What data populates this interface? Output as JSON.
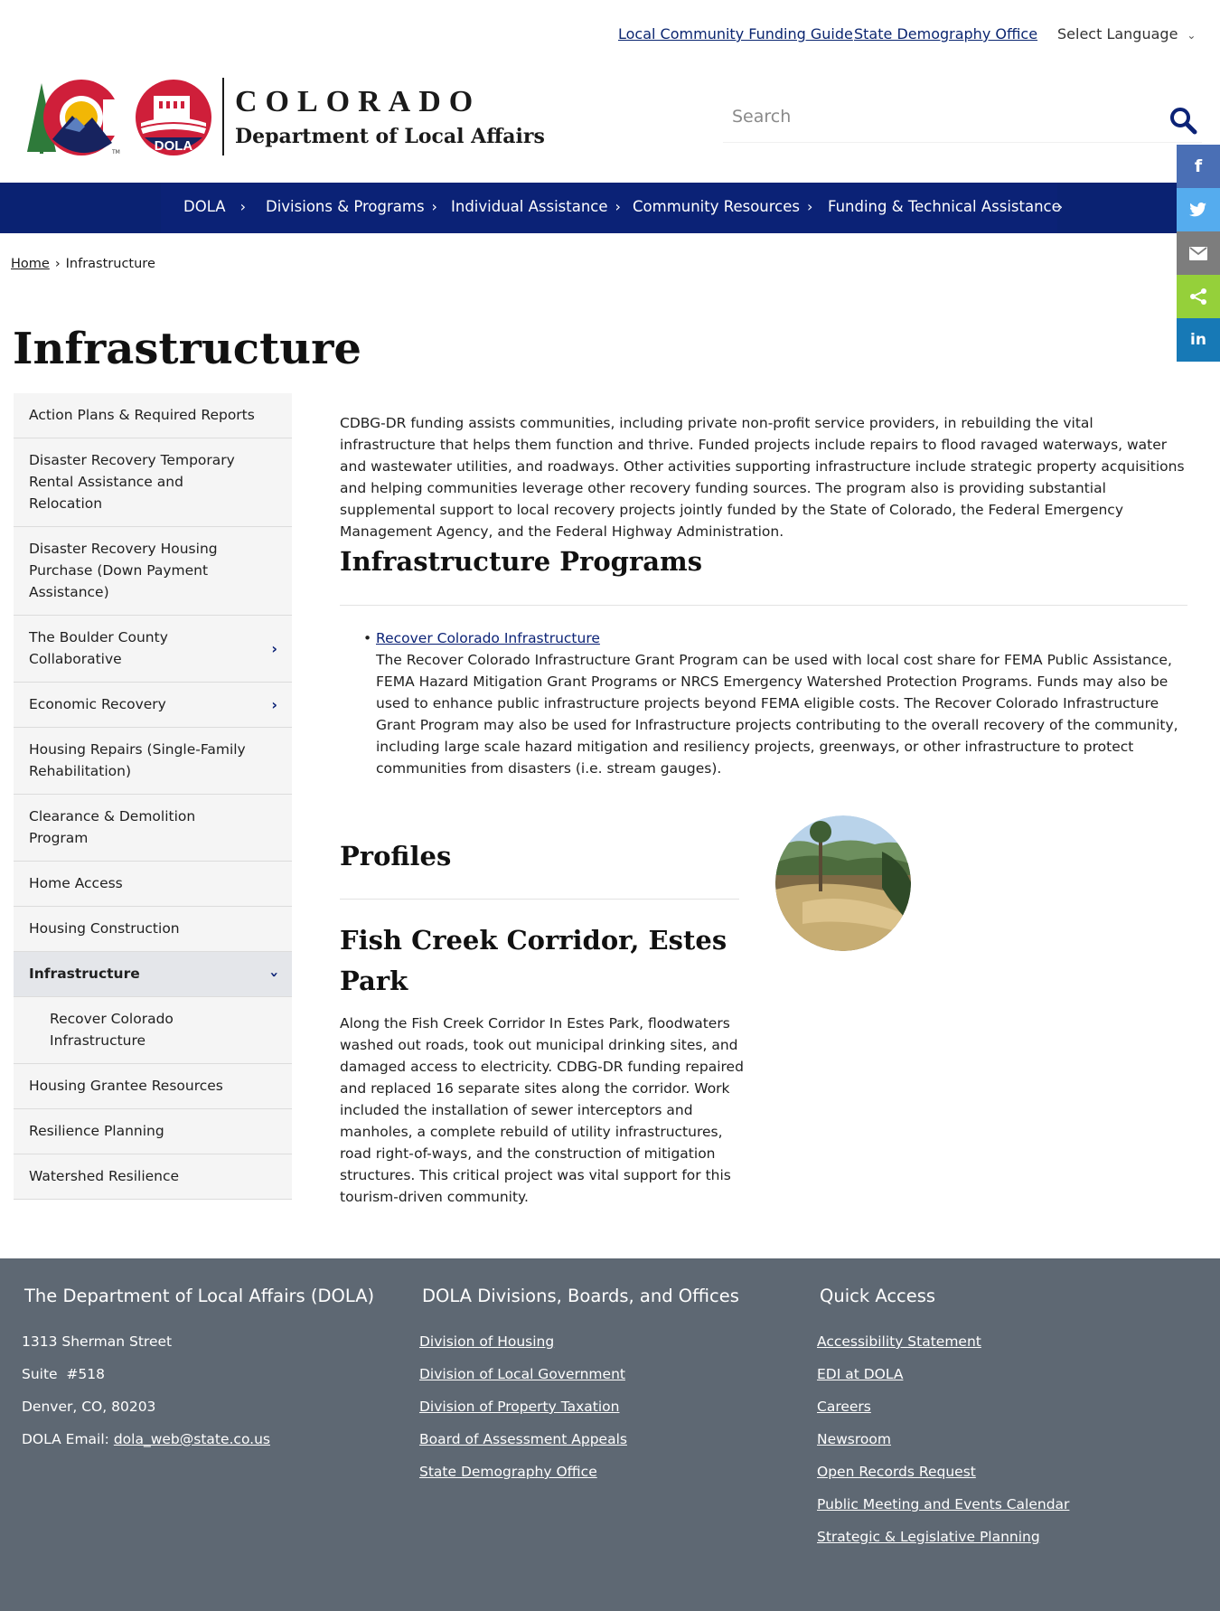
{
  "utility": {
    "link_1": "Local Community Funding Guide",
    "link_2": "State Demography Office",
    "language": "Select Language"
  },
  "header": {
    "logo_title": "COLORADO",
    "logo_subtitle": "Department of Local Affairs",
    "logo_badge": "DOLA",
    "search_placeholder": "Search"
  },
  "nav": {
    "items": [
      {
        "label": "DOLA"
      },
      {
        "label": "Divisions & Programs"
      },
      {
        "label": "Individual Assistance"
      },
      {
        "label": "Community Resources"
      },
      {
        "label": "Funding & Technical Assistance"
      }
    ]
  },
  "social": [
    "facebook-icon",
    "twitter-icon",
    "email-icon",
    "share-icon",
    "linkedin-icon"
  ],
  "breadcrumb": {
    "home": "Home",
    "current": "Infrastructure"
  },
  "page": {
    "title": "Infrastructure"
  },
  "sidebar": {
    "items": [
      {
        "label": "Action Plans & Required Reports"
      },
      {
        "label": "Disaster Recovery Temporary Rental Assistance and Relocation"
      },
      {
        "label": "Disaster Recovery Housing Purchase (Down Payment Assistance)"
      },
      {
        "label": "The Boulder County Collaborative"
      },
      {
        "label": "Economic Recovery"
      },
      {
        "label": "Housing Repairs (Single-Family Rehabilitation)"
      },
      {
        "label": "Clearance & Demolition Program"
      },
      {
        "label": "Home Access"
      },
      {
        "label": "Housing Construction"
      },
      {
        "label": "Infrastructure"
      },
      {
        "label": "Recover Colorado Infrastructure"
      },
      {
        "label": "Housing Grantee Resources"
      },
      {
        "label": "Resilience Planning"
      },
      {
        "label": "Watershed Resilience"
      }
    ]
  },
  "content": {
    "intro": "CDBG-DR funding assists communities, including private non-profit service providers, in rebuilding the vital infrastructure that helps them function and thrive. Funded projects include repairs to flood ravaged waterways, water and wastewater utilities, and roadways. Other activities supporting infrastructure include strategic property acquisitions and helping communities leverage other recovery funding sources. The program also is providing substantial supplemental support to local recovery projects jointly funded by the State of Colorado, the Federal Emergency Management Agency, and the Federal Highway Administration.",
    "programs_heading": "Infrastructure Programs",
    "program_link": "Recover Colorado Infrastructure",
    "program_text": "The Recover Colorado Infrastructure Grant Program can be used with local cost share for FEMA Public Assistance, FEMA Hazard Mitigation Grant Programs or NRCS Emergency Watershed Protection Programs. Funds may also be used to enhance public infrastructure projects beyond FEMA eligible costs. The Recover Colorado Infrastructure Grant Program may also be used for Infrastructure projects contributing to the overall recovery of the community, including large scale hazard mitigation and resiliency projects, greenways, or other infrastructure to protect communities from disasters (i.e. stream gauges).",
    "profiles_heading": "Profiles",
    "profile_title": "Fish Creek Corridor, Estes Park",
    "profile_text": "Along the Fish Creek Corridor In Estes Park, floodwaters washed out roads, took out municipal drinking sites, and damaged access to electricity. CDBG-DR funding repaired and replaced 16 separate sites along the corridor. Work included the installation of sewer interceptors and manholes, a complete rebuild of utility infrastructures, road right-of-ways, and the construction of mitigation structures. This critical project was vital support for this tourism-driven community."
  },
  "footer": {
    "col1": {
      "heading": "The Department of Local Affairs (DOLA)",
      "address_1": "1313 Sherman Street",
      "address_2": "Suite  #518",
      "address_3": "Denver, CO, 80203",
      "email_label": "DOLA Email: ",
      "email": "dola_web@state.co.us"
    },
    "col2": {
      "heading": "DOLA Divisions, Boards, and Offices",
      "links": [
        "Division of Housing",
        "Division of Local Government",
        "Division of Property Taxation",
        "Board of Assessment Appeals",
        "State Demography Office"
      ]
    },
    "col3": {
      "heading": "Quick Access",
      "links": [
        "Accessibility Statement",
        "EDI at DOLA",
        "Careers",
        "Newsroom",
        "Open Records Request",
        "Public Meeting and Events Calendar",
        "Strategic & Legislative Planning"
      ]
    }
  },
  "colors": {
    "nav_bg": "#0b2276",
    "link": "#0b2276",
    "footer_bg": "#5e6873",
    "sidebar_bg": "#f5f5f5",
    "sidebar_active_bg": "#e4e6ea"
  }
}
